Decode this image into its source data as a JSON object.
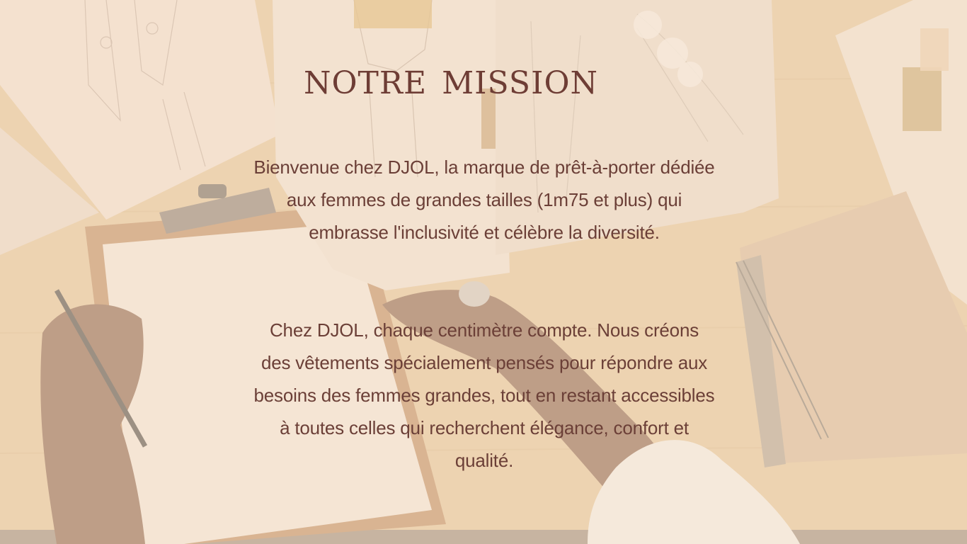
{
  "slide": {
    "title": "NOTRE  MISSION",
    "paragraphs": [
      "Bienvenue chez DJOL, la marque de prêt-à-porter dédiée aux femmes de grandes tailles (1m75 et plus) qui embrasse l'inclusivité et célèbre la diversité.",
      "Chez DJOL, chaque centimètre compte. Nous créons des vêtements spécialement pensés pour répondre aux besoins des femmes grandes, tout en restant accessibles à toutes celles qui recherchent élégance, confort et qualité."
    ]
  },
  "colors": {
    "text": "#6b3f37",
    "overlay": "#f6e4ce",
    "table": "#e8c89c"
  }
}
